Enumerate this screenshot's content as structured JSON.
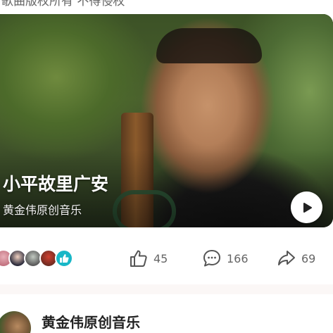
{
  "notice": "歌曲版权所有 不得侵权",
  "video": {
    "title": "小平故里广安",
    "author": "黄金伟原创音乐",
    "play_icon": "play-icon",
    "progress": 0
  },
  "stats": {
    "likes": "45",
    "comments": "166",
    "shares": "69"
  },
  "liker_avatars": [
    "avatar-1",
    "avatar-2",
    "avatar-3",
    "avatar-4"
  ],
  "author": {
    "name": "黄金伟原创音乐"
  },
  "colors": {
    "like_badge": "#18b7c7",
    "icon_gray": "#555555",
    "divider": "#fbf7f6"
  }
}
